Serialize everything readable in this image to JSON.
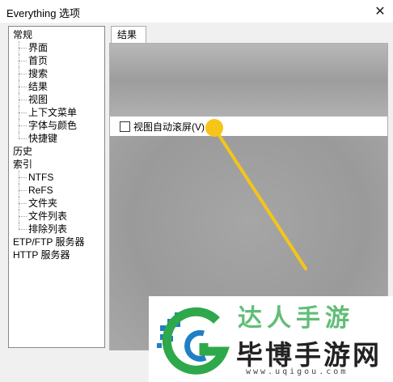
{
  "window": {
    "title": "Everything 选项",
    "close_glyph": "✕"
  },
  "tree": [
    {
      "label": "常规",
      "level": 0
    },
    {
      "label": "界面",
      "level": 1
    },
    {
      "label": "首页",
      "level": 1
    },
    {
      "label": "搜索",
      "level": 1
    },
    {
      "label": "结果",
      "level": 1
    },
    {
      "label": "视图",
      "level": 1
    },
    {
      "label": "上下文菜单",
      "level": 1
    },
    {
      "label": "字体与颜色",
      "level": 1
    },
    {
      "label": "快捷键",
      "level": 1
    },
    {
      "label": "历史",
      "level": 0
    },
    {
      "label": "索引",
      "level": 0
    },
    {
      "label": "NTFS",
      "level": 1
    },
    {
      "label": "ReFS",
      "level": 1
    },
    {
      "label": "文件夹",
      "level": 1
    },
    {
      "label": "文件列表",
      "level": 1
    },
    {
      "label": "排除列表",
      "level": 1
    },
    {
      "label": "ETP/FTP 服务器",
      "level": 0
    },
    {
      "label": "HTTP 服务器",
      "level": 0
    }
  ],
  "tab": {
    "label": "结果"
  },
  "options": {
    "auto_scroll_label": "视图自动滚屏(V)",
    "auto_scroll_checked": false
  },
  "annotation": {
    "color": "#f5c518"
  },
  "watermark": {
    "top_text": "达人手游",
    "main_text": "毕博手游网",
    "url": "www.uqigou.com",
    "logo_text": "G"
  }
}
